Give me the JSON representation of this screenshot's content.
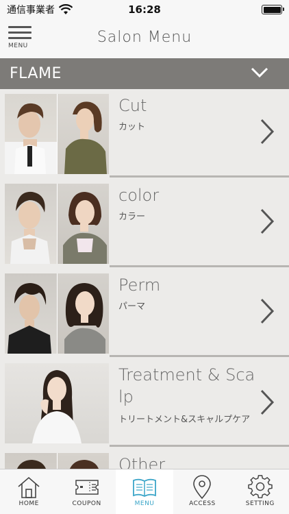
{
  "status_bar": {
    "carrier": "通信事業者",
    "time": "16:28"
  },
  "nav": {
    "menu_label": "MENU",
    "title": "Salon Menu"
  },
  "section": {
    "title": "FLAME"
  },
  "items": [
    {
      "title": "Cut",
      "subtitle": "カット"
    },
    {
      "title": "color",
      "subtitle": "カラー"
    },
    {
      "title": "Perm",
      "subtitle": "パーマ"
    },
    {
      "title": "Treatment & Scalp",
      "subtitle": "トリートメント&スキャルプケア"
    },
    {
      "title": "Other",
      "subtitle": ""
    }
  ],
  "tabs": [
    {
      "label": "HOME",
      "icon": "home-icon"
    },
    {
      "label": "COUPON",
      "icon": "ticket-icon"
    },
    {
      "label": "MENU",
      "icon": "book-icon"
    },
    {
      "label": "ACCESS",
      "icon": "map-pin-icon"
    },
    {
      "label": "SETTING",
      "icon": "gear-icon"
    }
  ],
  "colors": {
    "accent": "#3aa5c8",
    "section_header": "#7d7b78",
    "background": "#ecebe9"
  }
}
